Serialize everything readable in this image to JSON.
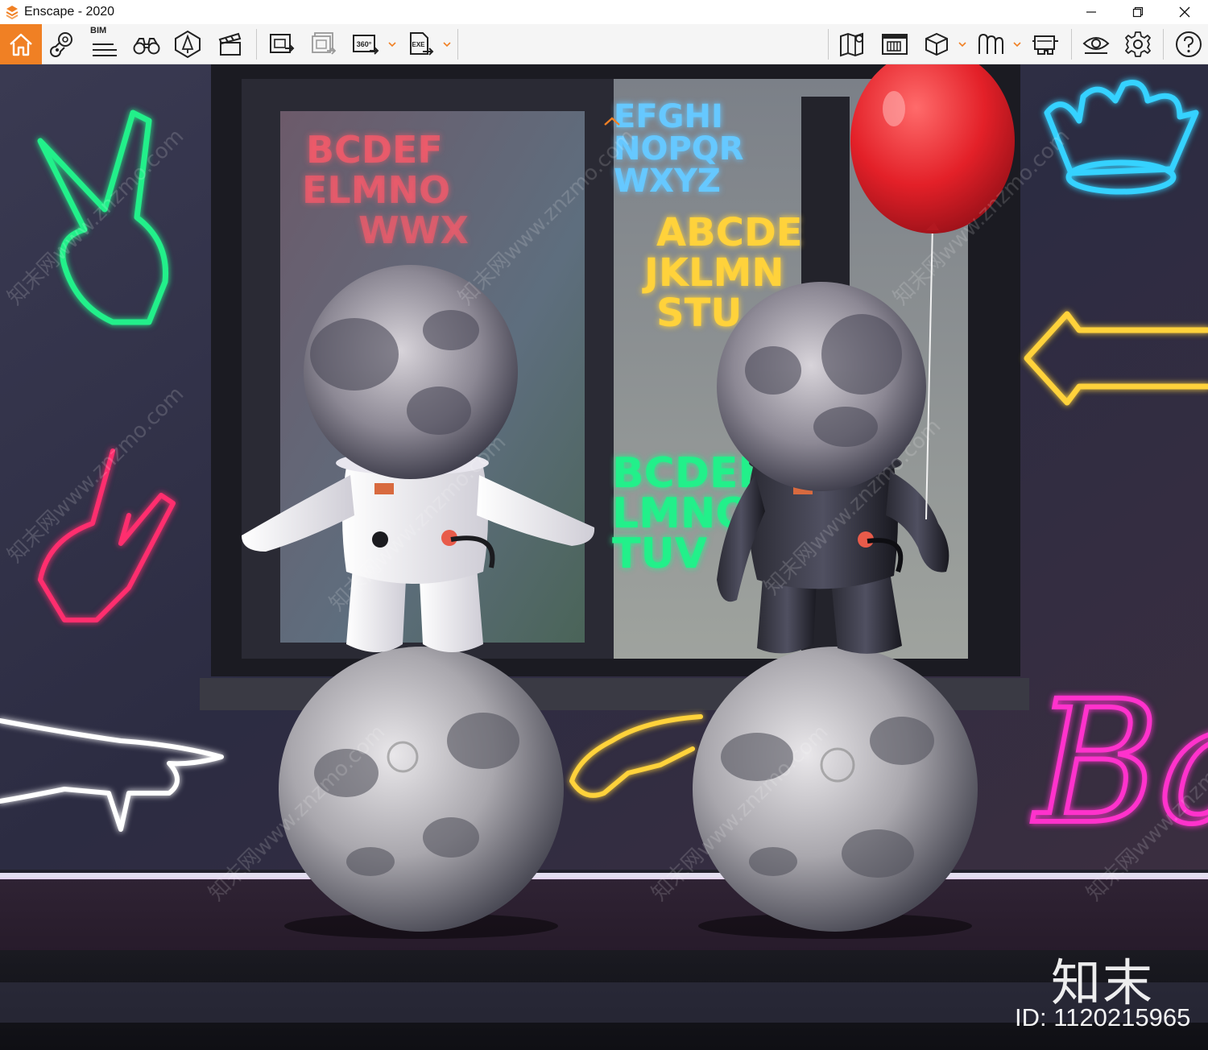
{
  "window": {
    "title": "Enscape - 2020",
    "brand_color": "#f08024"
  },
  "toolbar": {
    "left_tools": [
      {
        "name": "home",
        "icon": "home-icon"
      },
      {
        "name": "views",
        "icon": "map-pin-icon"
      },
      {
        "name": "bim",
        "icon": "bim-list-icon",
        "label": "BIM"
      },
      {
        "name": "binoculars",
        "icon": "binoculars-icon"
      },
      {
        "name": "asset-library",
        "icon": "asset-library-icon"
      },
      {
        "name": "video-editor",
        "icon": "clapperboard-icon"
      },
      {
        "name": "render-image",
        "icon": "render-image-icon"
      },
      {
        "name": "batch-render",
        "icon": "batch-render-icon"
      },
      {
        "name": "panorama",
        "icon": "panorama-360-icon",
        "label": "360°"
      },
      {
        "name": "export-exe",
        "icon": "export-exe-icon",
        "label": "EXE"
      }
    ],
    "right_tools": [
      {
        "name": "map",
        "icon": "map-icon"
      },
      {
        "name": "material-editor",
        "icon": "material-editor-icon"
      },
      {
        "name": "cube",
        "icon": "cube-icon"
      },
      {
        "name": "collaborative-annotation",
        "icon": "annotation-icon"
      },
      {
        "name": "vr-headset",
        "icon": "vr-headset-icon"
      },
      {
        "name": "visual-settings",
        "icon": "eye-icon"
      },
      {
        "name": "general-settings",
        "icon": "gear-icon"
      },
      {
        "name": "help",
        "icon": "help-icon"
      }
    ]
  },
  "scene": {
    "neon_letters": {
      "left_window": [
        "BCDEF",
        "ELMNO",
        "WWX"
      ],
      "right_window_top": [
        "EFGHI",
        "NOPQR",
        "WXYZ"
      ],
      "yellow": [
        "ABCDE",
        "JKLMN",
        "STU"
      ],
      "green": [
        "BCDEF",
        "LMNO",
        "TUV"
      ],
      "pink_sign": "Ba"
    },
    "colors": {
      "neon_green": "#22f08a",
      "neon_pink": "#ff2d6e",
      "neon_cyan": "#35d2ff",
      "neon_yellow": "#ffd23a",
      "neon_magenta": "#ff33cc",
      "balloon_red": "#e32028"
    }
  },
  "watermark": {
    "logo": "知末",
    "id": "ID: 1120215965",
    "repeat_text": "知末网www.znzmo.com"
  }
}
